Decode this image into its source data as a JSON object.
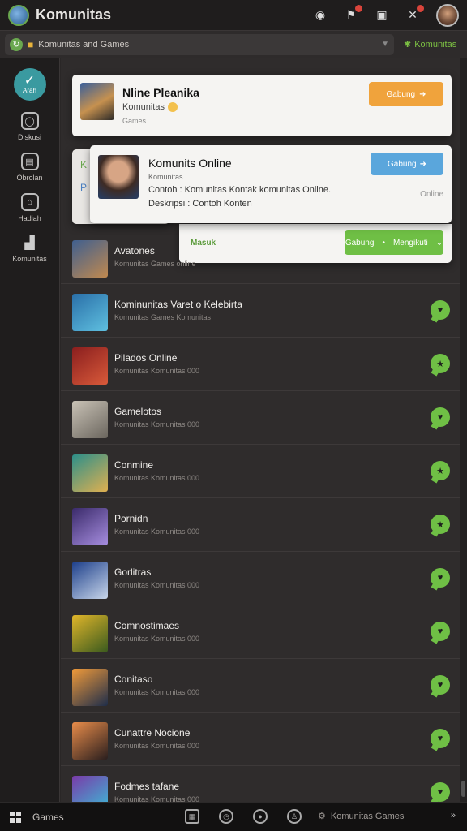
{
  "app": {
    "title": "Komunitas"
  },
  "address": {
    "text": "Komunitas and Games",
    "action": "Komunitas"
  },
  "sidebar": {
    "main_label": "Arah",
    "items": [
      {
        "label": "Diskusi",
        "icon": "chat-icon"
      },
      {
        "label": "Obrolan",
        "icon": "film-icon"
      },
      {
        "label": "Hadiah",
        "icon": "gift-icon"
      },
      {
        "label": "Komunitas",
        "icon": "community-icon"
      }
    ]
  },
  "card1": {
    "title": "Nline Pleanika",
    "subtitle": "Komunitas",
    "meta": "Games",
    "button": "Gabung"
  },
  "card2": {
    "title": "Komunits Online",
    "line2": "Komunitas",
    "line3": "Contoh : Komunitas Kontak komunitas Online.",
    "line4": "Deskripsi : Contoh Konten",
    "button": "Gabung",
    "side_text": "Online"
  },
  "card2back": {
    "line1": "K",
    "line2": "P"
  },
  "card3": {
    "text": "Masuk",
    "button_left": "Gabung",
    "button_right": "Mengikuti"
  },
  "rows": [
    {
      "name": "Avatones",
      "meta": "Komunitas Games online",
      "colors": [
        "#3f5f8f",
        "#c0894f"
      ]
    },
    {
      "name": "Kominunitas Varet o Kelebirta",
      "meta": "Komunitas Games Komunitas",
      "colors": [
        "#2a6fa8",
        "#5fc0e0"
      ]
    },
    {
      "name": "Pilados Online",
      "meta": "Komunitas Komunitas 000",
      "colors": [
        "#8a1e1e",
        "#d95a3a"
      ]
    },
    {
      "name": "Gamelotos",
      "meta": "Komunitas Komunitas 000",
      "colors": [
        "#c9c2b6",
        "#6b665e"
      ]
    },
    {
      "name": "Conmine",
      "meta": "Komunitas Komunitas 000",
      "colors": [
        "#2c8f8a",
        "#e0b050"
      ]
    },
    {
      "name": "Pornidn",
      "meta": "Komunitas Komunitas 000",
      "colors": [
        "#3a2a6a",
        "#a78ee0"
      ]
    },
    {
      "name": "Gorlitras",
      "meta": "Komunitas Komunitas 000",
      "colors": [
        "#1d3f8a",
        "#c8d6ea"
      ]
    },
    {
      "name": "Comnostimaes",
      "meta": "Komunitas Komunitas 000",
      "colors": [
        "#e0b52a",
        "#3a5a1e"
      ]
    },
    {
      "name": "Conitaso",
      "meta": "Komunitas Komunitas 000",
      "colors": [
        "#f09a3a",
        "#1e2d4a"
      ]
    },
    {
      "name": "Cunattre Nocione",
      "meta": "Komunitas Komunitas 000",
      "colors": [
        "#e88c4a",
        "#2a1e1e"
      ]
    },
    {
      "name": "Fodmes tafane",
      "meta": "Komunitas Komunitas 000",
      "colors": [
        "#7a3aa8",
        "#3ac0d8"
      ]
    }
  ],
  "taskbar": {
    "label": "Games",
    "right": "Komunitas Games"
  }
}
